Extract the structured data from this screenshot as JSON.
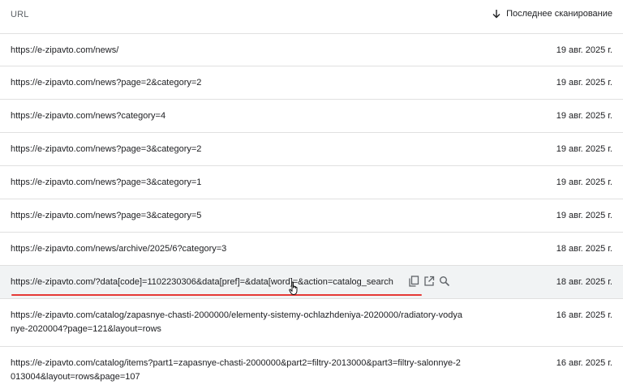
{
  "header": {
    "url_label": "URL",
    "date_label": "Последнее сканирование",
    "sort_icon": "arrow-down-icon"
  },
  "rows": [
    {
      "url": "https://e-zipavto.com/news/",
      "date": "19 авг. 2025 г."
    },
    {
      "url": "https://e-zipavto.com/news?page=2&category=2",
      "date": "19 авг. 2025 г."
    },
    {
      "url": "https://e-zipavto.com/news?category=4",
      "date": "19 авг. 2025 г."
    },
    {
      "url": "https://e-zipavto.com/news?page=3&category=2",
      "date": "19 авг. 2025 г."
    },
    {
      "url": "https://e-zipavto.com/news?page=3&category=1",
      "date": "19 авг. 2025 г."
    },
    {
      "url": "https://e-zipavto.com/news?page=3&category=5",
      "date": "19 авг. 2025 г."
    },
    {
      "url": "https://e-zipavto.com/news/archive/2025/6?category=3",
      "date": "18 авг. 2025 г."
    },
    {
      "url": "https://e-zipavto.com/?data[code]=1102230306&data[pref]=&data[word]=&action=catalog_search",
      "date": "18 авг. 2025 г.",
      "actions": [
        "copy-icon",
        "open-in-new-icon",
        "search-icon"
      ]
    },
    {
      "url": "https://e-zipavto.com/catalog/zapasnye-chasti-2000000/elementy-sistemy-ochlazhdeniya-2020000/radiatory-vodyanye-2020004?page=121&layout=rows",
      "date": "16 авг. 2025 г."
    },
    {
      "url": "https://e-zipavto.com/catalog/items?part1=zapasnye-chasti-2000000&part2=filtry-2013000&part3=filtry-salonnye-2013004&layout=rows&page=107",
      "date": "16 авг. 2025 г."
    }
  ],
  "colors": {
    "highlight_underline": "#e53935",
    "row_hover": "#f1f3f4",
    "divider": "#e0e0e0"
  }
}
